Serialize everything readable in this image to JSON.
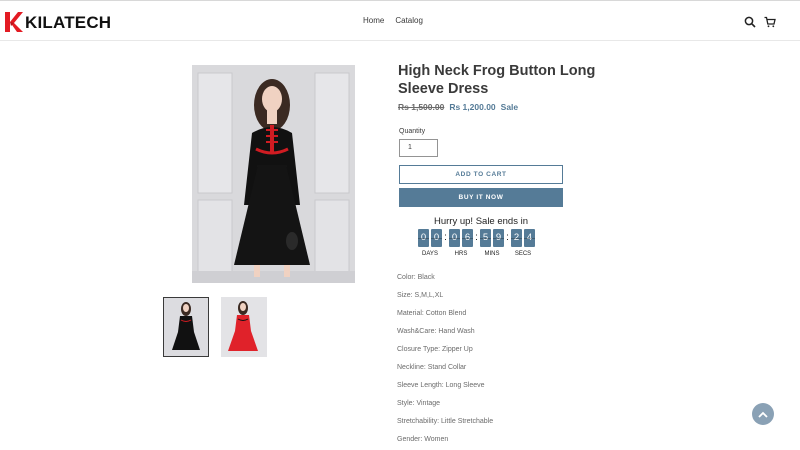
{
  "brand": {
    "name": "KILATECH",
    "accent_color": "#e31b23"
  },
  "nav": {
    "items": [
      "Home",
      "Catalog"
    ]
  },
  "header_icons": [
    "search-icon",
    "cart-icon"
  ],
  "product": {
    "title": "High Neck Frog Button Long Sleeve Dress",
    "price_original": "Rs 1,500.00",
    "price_sale": "Rs 1,200.00",
    "sale_label": "Sale",
    "quantity_label": "Quantity",
    "quantity_value": "1",
    "add_to_cart_label": "ADD TO CART",
    "buy_now_label": "BUY IT NOW",
    "accent_color": "#557b97"
  },
  "countdown": {
    "heading": "Hurry up! Sale ends in",
    "days": [
      "0",
      "0"
    ],
    "hours": [
      "0",
      "6"
    ],
    "mins": [
      "5",
      "9"
    ],
    "secs": [
      "2",
      "4"
    ],
    "labels": {
      "days": "DAYS",
      "hrs": "HRS",
      "mins": "MINS",
      "secs": "SECS"
    }
  },
  "specs": [
    "Color: Black",
    "Size: S,M,L,XL",
    "Material: Cotton Blend",
    "Wash&Care: Hand Wash",
    "Closure Type: Zipper Up",
    "Neckline: Stand Collar",
    "Sleeve Length: Long Sleeve",
    "Style: Vintage",
    "Stretchability: Little Stretchable",
    "Gender: Women"
  ]
}
